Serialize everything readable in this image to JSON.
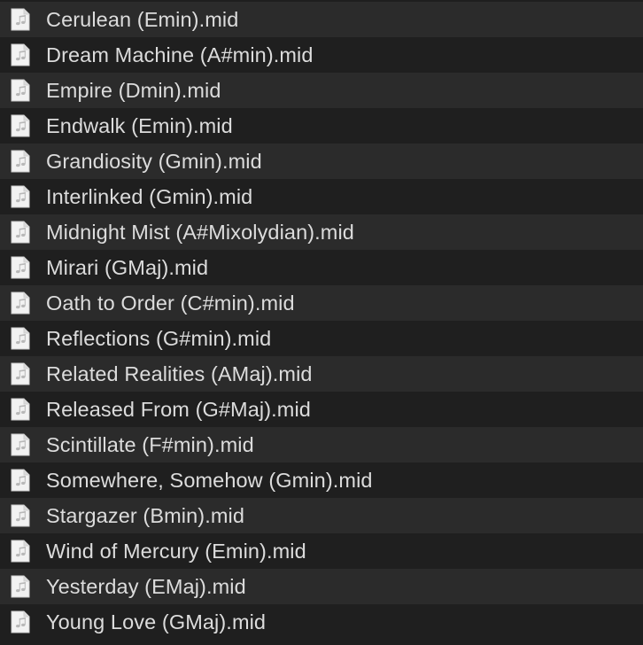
{
  "files": [
    {
      "name": "Cerulean (Emin).mid",
      "icon": "midi-file-icon"
    },
    {
      "name": "Dream Machine (A#min).mid",
      "icon": "midi-file-icon"
    },
    {
      "name": "Empire (Dmin).mid",
      "icon": "midi-file-icon"
    },
    {
      "name": "Endwalk (Emin).mid",
      "icon": "midi-file-icon"
    },
    {
      "name": "Grandiosity (Gmin).mid",
      "icon": "midi-file-icon"
    },
    {
      "name": "Interlinked (Gmin).mid",
      "icon": "midi-file-icon"
    },
    {
      "name": "Midnight Mist (A#Mixolydian).mid",
      "icon": "midi-file-icon"
    },
    {
      "name": "Mirari (GMaj).mid",
      "icon": "midi-file-icon"
    },
    {
      "name": "Oath to Order (C#min).mid",
      "icon": "midi-file-icon"
    },
    {
      "name": "Reflections (G#min).mid",
      "icon": "midi-file-icon"
    },
    {
      "name": "Related Realities (AMaj).mid",
      "icon": "midi-file-icon"
    },
    {
      "name": "Released From (G#Maj).mid",
      "icon": "midi-file-icon"
    },
    {
      "name": "Scintillate (F#min).mid",
      "icon": "midi-file-icon"
    },
    {
      "name": "Somewhere, Somehow (Gmin).mid",
      "icon": "midi-file-icon"
    },
    {
      "name": "Stargazer (Bmin).mid",
      "icon": "midi-file-icon"
    },
    {
      "name": "Wind of Mercury (Emin).mid",
      "icon": "midi-file-icon"
    },
    {
      "name": "Yesterday (EMaj).mid",
      "icon": "midi-file-icon"
    },
    {
      "name": "Young Love (GMaj).mid",
      "icon": "midi-file-icon"
    }
  ],
  "colors": {
    "row_odd": "#2b2b2b",
    "row_even": "#1f1f1f",
    "text": "#dcdcdc",
    "icon_page": "#f2f2f2",
    "icon_glyph": "#b8b8b8"
  }
}
